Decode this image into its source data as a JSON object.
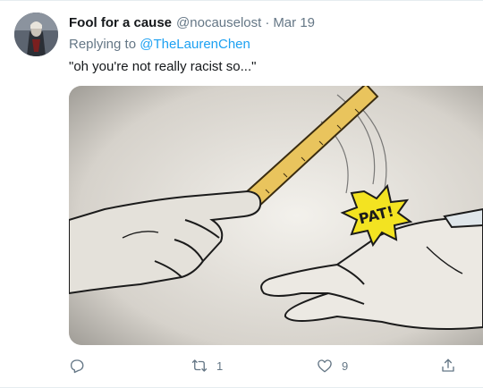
{
  "tweet": {
    "author": {
      "display_name": "Fool for a cause",
      "handle": "@nocauselost"
    },
    "separator": "·",
    "date": "Mar 19",
    "reply_prefix": "Replying to",
    "reply_to": "@TheLaurenChen",
    "text": "\"oh you're not really racist so...\"",
    "media": {
      "sound_effect": "PAT!",
      "icon": "comic-illustration"
    },
    "actions": {
      "reply": {
        "icon": "reply-icon",
        "count": ""
      },
      "retweet": {
        "icon": "retweet-icon",
        "count": "1"
      },
      "like": {
        "icon": "like-icon",
        "count": "9"
      },
      "share": {
        "icon": "share-icon"
      }
    }
  },
  "colors": {
    "primary_text": "#14171a",
    "secondary_text": "#657786",
    "link": "#1da1f2",
    "divider": "#e6ecf0"
  }
}
